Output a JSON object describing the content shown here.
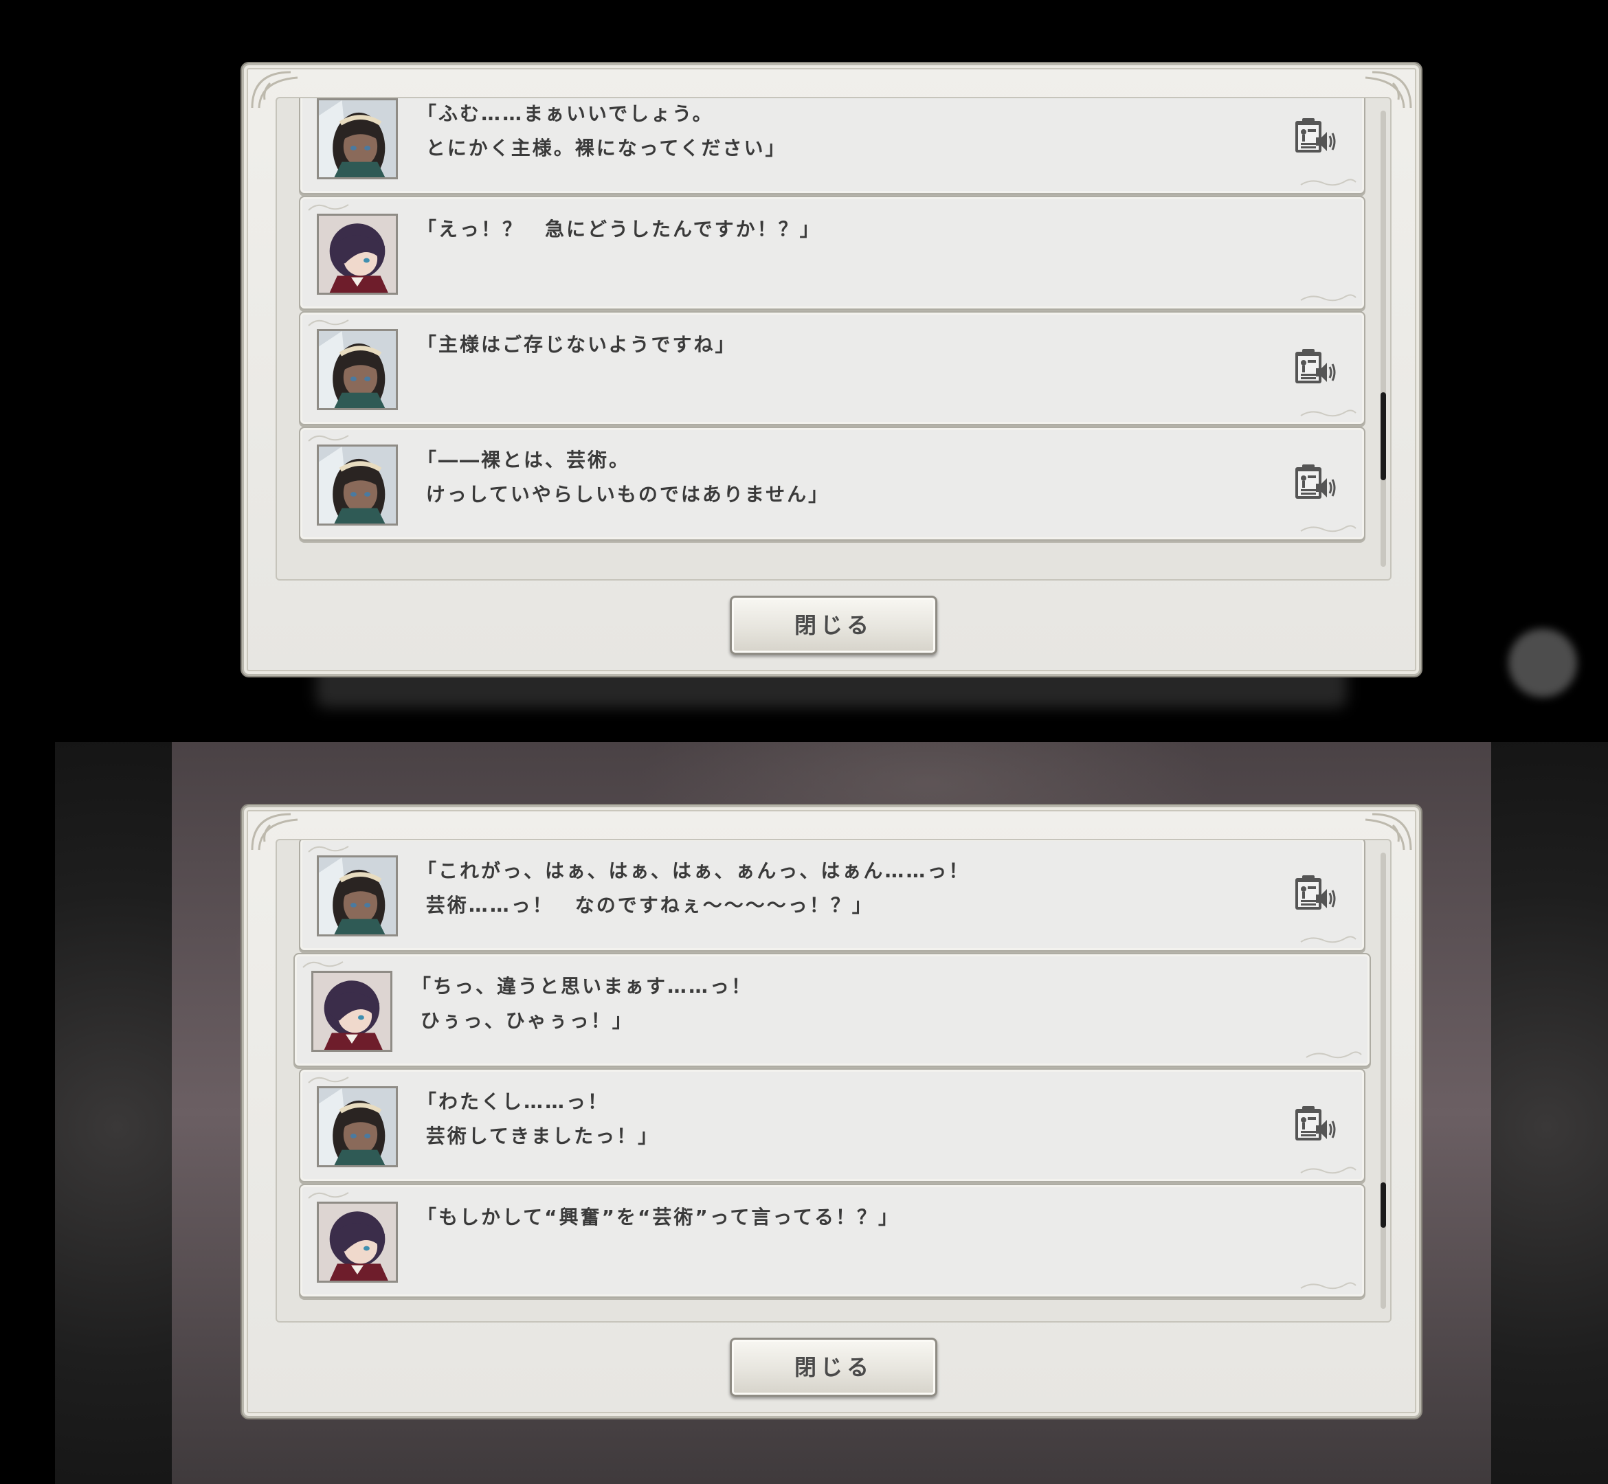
{
  "close_button_label": "閉じる",
  "panels": [
    {
      "entries": [
        {
          "speaker": "dark-hair-maid",
          "text": "「ふむ……まぁいいでしょう。\n とにかく主様。裸になってください」",
          "has_voice": true
        },
        {
          "speaker": "purple-hair-master",
          "text": "「えっ！？　急にどうしたんですか！？」",
          "has_voice": false
        },
        {
          "speaker": "dark-hair-maid",
          "text": "「主様はご存じないようですね」",
          "has_voice": true
        },
        {
          "speaker": "dark-hair-maid",
          "text": "「――裸とは、芸術。\n けっしていやらしいものではありません」",
          "has_voice": true
        }
      ]
    },
    {
      "entries": [
        {
          "speaker": "dark-hair-maid",
          "text": "「これがっ、はぁ、はぁ、はぁ、ぁんっ、はぁん……っ！\n 芸術……っ！　なのですねぇ～～～～っ！？」",
          "has_voice": true
        },
        {
          "speaker": "purple-hair-master",
          "text": "「ちっ、違うと思いまぁす……っ！\n ひぅっ、ひゃぅっ！」",
          "has_voice": false
        },
        {
          "speaker": "dark-hair-maid",
          "text": "「わたくし……っ！\n 芸術してきましたっ！」",
          "has_voice": true
        },
        {
          "speaker": "purple-hair-master",
          "text": "「もしかして“興奮”を“芸術”って言ってる！？」",
          "has_voice": false
        }
      ]
    }
  ],
  "icons": {
    "voice": "voice-replay-icon",
    "portrait_maid": "dark-hair-maid-portrait",
    "portrait_master": "purple-hair-master-portrait"
  },
  "colors": {
    "panel_bg": "#ebebea",
    "text": "#3a3a3a",
    "frame": "#b9b7ad",
    "scroll_thumb": "#1a1a1a"
  }
}
